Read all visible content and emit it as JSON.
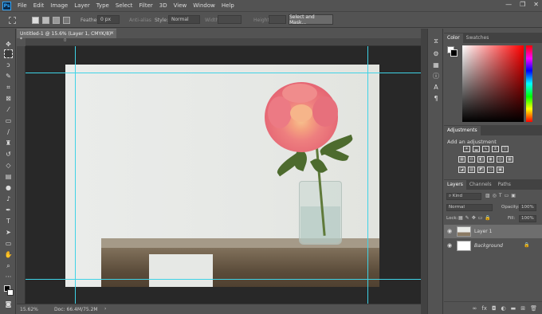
{
  "app": {
    "logo": "Ps"
  },
  "menu": [
    "File",
    "Edit",
    "Image",
    "Layer",
    "Type",
    "Select",
    "Filter",
    "3D",
    "View",
    "Window",
    "Help"
  ],
  "window_controls": {
    "minimize": "—",
    "restore": "❐",
    "close": "✕"
  },
  "options": {
    "feather_label": "Feather:",
    "feather_value": "0 px",
    "antialias_label": "Anti-alias",
    "style_label": "Style:",
    "style_value": "Normal",
    "width_label": "Width:",
    "height_label": "Height:",
    "select_mask_label": "Select and Mask..."
  },
  "document": {
    "tab_title": "Untitled-1 @ 15.6% (Layer 1, CMYK/8) *",
    "close": "×"
  },
  "ruler_top_labels": [
    "",
    "0",
    "",
    "",
    "",
    "",
    "",
    "",
    "",
    "",
    "",
    "",
    "",
    "",
    "",
    "",
    "",
    ""
  ],
  "status": {
    "zoom": "15.62%",
    "doc": "Doc: 66.4M/75.2M",
    "arrow": "›"
  },
  "panels": {
    "color_tabs": [
      "Color",
      "Swatches"
    ],
    "adjustments_tab": "Adjustments",
    "adjustments_heading": "Add an adjustment",
    "layers_tabs": [
      "Layers",
      "Channels",
      "Paths"
    ],
    "kind_label": "Kind",
    "blend_mode": "Normal",
    "opacity_label": "Opacity:",
    "opacity_value": "100%",
    "lock_label": "Lock:",
    "fill_label": "Fill:",
    "fill_value": "100%",
    "layers": [
      {
        "name": "Layer 1",
        "selected": true
      },
      {
        "name": "Background",
        "selected": false,
        "locked": true
      }
    ],
    "footer_icons": [
      "link-icon",
      "fx-icon",
      "mask-icon",
      "adjustment-icon",
      "folder-icon",
      "new-layer-icon",
      "trash-icon"
    ]
  },
  "colors": {
    "guide": "#3fd3e6",
    "ui_bg": "#535353",
    "pasteboard": "#282828",
    "ps_blue": "#31a8ff"
  }
}
